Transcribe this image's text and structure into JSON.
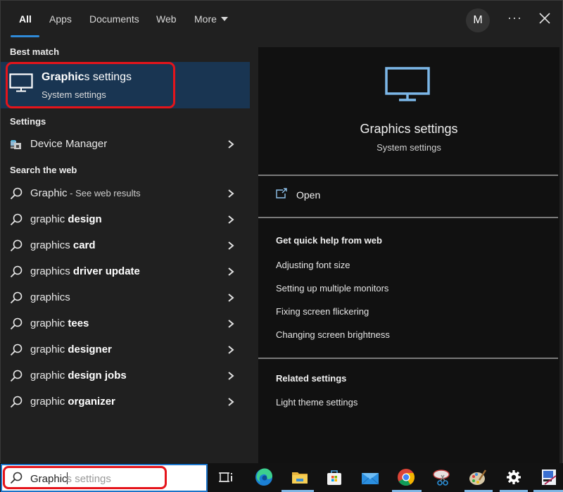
{
  "tabs": [
    {
      "label": "All",
      "active": true
    },
    {
      "label": "Apps"
    },
    {
      "label": "Documents"
    },
    {
      "label": "Web"
    },
    {
      "label": "More"
    }
  ],
  "header": {
    "avatar_initial": "M",
    "more_label": "···"
  },
  "left": {
    "best_match_heading": "Best match",
    "best_match": {
      "title_bold": "Graphic",
      "title_rest": "s settings",
      "subtitle": "System settings",
      "icon": "monitor-icon"
    },
    "settings_heading": "Settings",
    "settings_items": [
      {
        "label": "Device Manager",
        "icon": "device-manager-icon"
      }
    ],
    "web_heading": "Search the web",
    "web_items": [
      {
        "normal": "Graphic",
        "bold": "",
        "hint": " - See web results"
      },
      {
        "normal": "graphic ",
        "bold": "design",
        "hint": ""
      },
      {
        "normal": "graphics ",
        "bold": "card",
        "hint": ""
      },
      {
        "normal": "graphics ",
        "bold": "driver update",
        "hint": ""
      },
      {
        "normal": "graphics",
        "bold": "",
        "hint": ""
      },
      {
        "normal": "graphic ",
        "bold": "tees",
        "hint": ""
      },
      {
        "normal": "graphic ",
        "bold": "designer",
        "hint": ""
      },
      {
        "normal": "graphic ",
        "bold": "design jobs",
        "hint": ""
      },
      {
        "normal": "graphic ",
        "bold": "organizer",
        "hint": ""
      }
    ]
  },
  "preview": {
    "title": "Graphics settings",
    "subtitle": "System settings",
    "open_label": "Open",
    "help_heading": "Get quick help from web",
    "help_links": [
      "Adjusting font size",
      "Setting up multiple monitors",
      "Fixing screen flickering",
      "Changing screen brightness"
    ],
    "related_heading": "Related settings",
    "related_links": [
      "Light theme settings"
    ]
  },
  "taskbar": {
    "search_typed": "Graphic",
    "search_suggestion": "s settings",
    "apps": [
      "task-view",
      "edge",
      "file-explorer",
      "microsoft-store",
      "mail",
      "chrome",
      "snipping-tool",
      "paint",
      "settings",
      "remote-app"
    ]
  },
  "colors": {
    "accent": "#2f8ad8",
    "highlight": "#193552",
    "annotation": "#e5141b",
    "icon_blue": "#7cb7e8"
  }
}
